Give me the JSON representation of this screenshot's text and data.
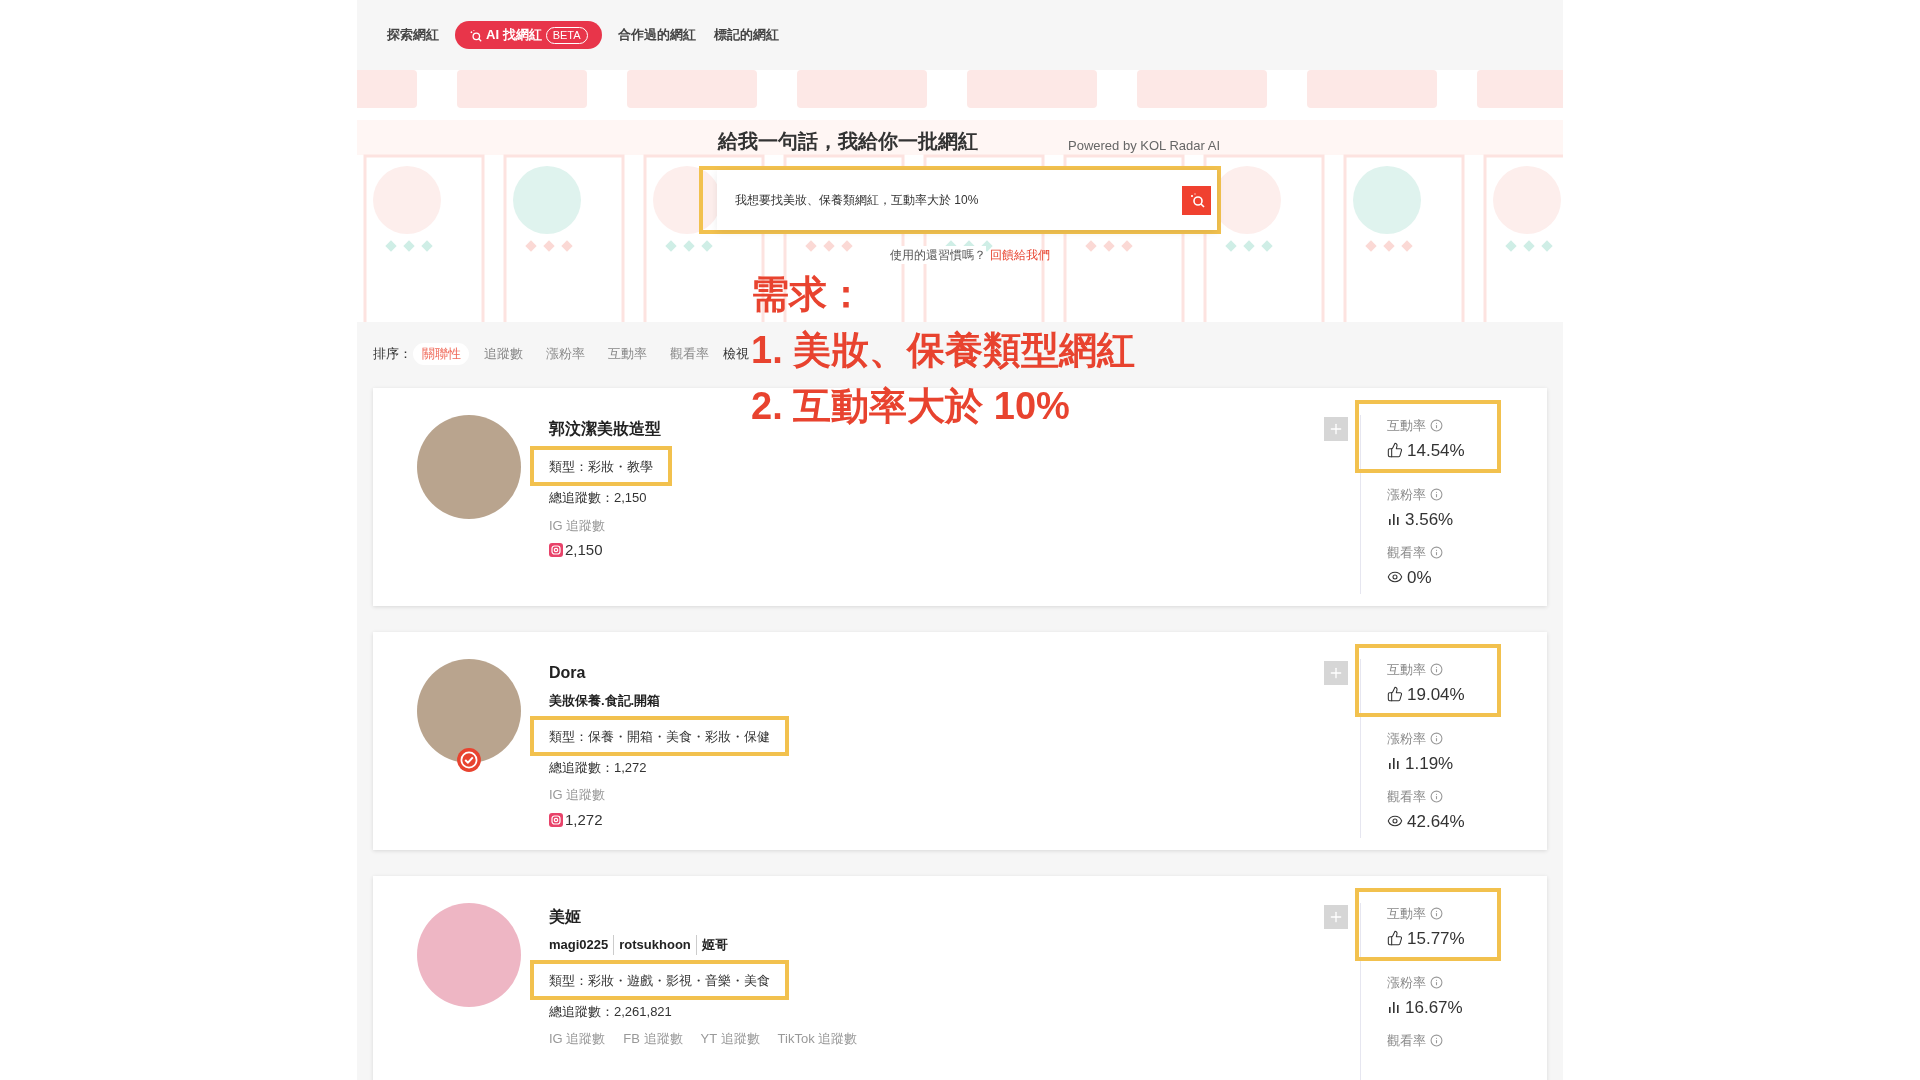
{
  "nav_tabs": [
    {
      "label": "探索網紅",
      "selected": false
    },
    {
      "label": "AI 找網紅",
      "badge": "BETA",
      "selected": true
    },
    {
      "label": "合作過的網紅",
      "selected": false
    },
    {
      "label": "標記的網紅",
      "selected": false
    }
  ],
  "hero": {
    "title": "給我一句話，我給你一批網紅",
    "powered_by": "Powered by KOL Radar AI",
    "search": {
      "value": "我想要找美妝、保養類網紅，互動率大於 10%",
      "highlighted": true
    },
    "feedback_text": "使用的還習慣嗎？",
    "feedback_link": "回饋給我們"
  },
  "annotation": {
    "heading": "需求：",
    "lines": [
      "1. 美妝、保養類型網紅",
      "2. 互動率大於 10%"
    ]
  },
  "sort": {
    "label": "排序：",
    "options": [
      {
        "label": "關聯性",
        "selected": true
      },
      {
        "label": "追蹤數",
        "selected": false
      },
      {
        "label": "漲粉率",
        "selected": false
      },
      {
        "label": "互動率",
        "selected": false
      },
      {
        "label": "觀看率",
        "selected": false
      }
    ],
    "view_label": "檢視"
  },
  "cards": [
    {
      "name": "郭汶潔美妝造型",
      "verified": false,
      "type": "類型：彩妝・教學",
      "type_highlighted": true,
      "total_followers": "總追蹤數：2,150",
      "platforms": [
        {
          "label": "IG 追蹤數",
          "value": "2,150"
        }
      ],
      "metrics": [
        {
          "kind": "engagement",
          "label": "互動率",
          "value": "14.54%",
          "highlighted": true
        },
        {
          "kind": "growth",
          "label": "漲粉率",
          "value": "3.56%",
          "highlighted": false
        },
        {
          "kind": "views",
          "label": "觀看率",
          "value": "0%",
          "highlighted": false
        }
      ]
    },
    {
      "name": "Dora",
      "subtitle": "美妝保養.食記.開箱",
      "verified": true,
      "type": "類型：保養・開箱・美食・彩妝・保健",
      "type_highlighted": true,
      "total_followers": "總追蹤數：1,272",
      "platforms": [
        {
          "label": "IG 追蹤數",
          "value": "1,272"
        }
      ],
      "metrics": [
        {
          "kind": "engagement",
          "label": "互動率",
          "value": "19.04%",
          "highlighted": true
        },
        {
          "kind": "growth",
          "label": "漲粉率",
          "value": "1.19%",
          "highlighted": false
        },
        {
          "kind": "views",
          "label": "觀看率",
          "value": "42.64%",
          "highlighted": false
        }
      ]
    },
    {
      "name": "美姬",
      "handles": [
        "magi0225",
        "rotsukhoon",
        "姬哥"
      ],
      "verified": false,
      "type": "類型：彩妝・遊戲・影視・音樂・美食",
      "type_highlighted": true,
      "total_followers": "總追蹤數：2,261,821",
      "platforms": [
        {
          "label": "IG 追蹤數"
        },
        {
          "label": "FB 追蹤數"
        },
        {
          "label": "YT 追蹤數"
        },
        {
          "label": "TikTok 追蹤數"
        }
      ],
      "metrics": [
        {
          "kind": "engagement",
          "label": "互動率",
          "value": "15.77%",
          "highlighted": true
        },
        {
          "kind": "growth",
          "label": "漲粉率",
          "value": "16.67%",
          "highlighted": false
        },
        {
          "label": "觀看率",
          "highlighted": false
        }
      ]
    }
  ]
}
